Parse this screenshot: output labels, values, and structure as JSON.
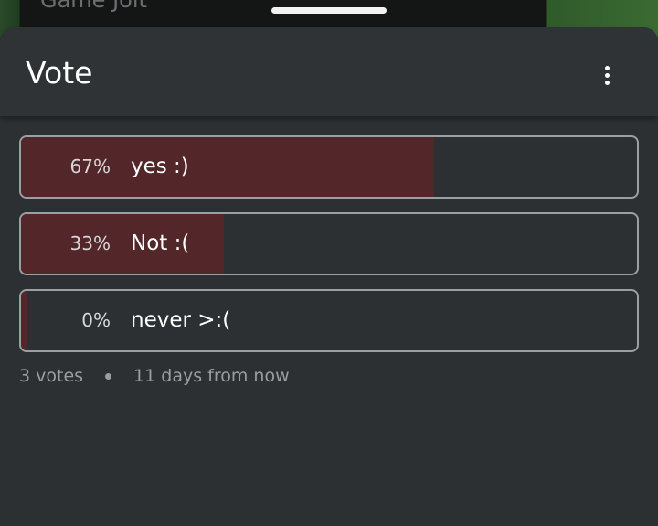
{
  "background": {
    "app_title": "Game Jolt"
  },
  "sheet": {
    "title": "Vote"
  },
  "poll": {
    "options": [
      {
        "percent_label": "67%",
        "label": "yes :)",
        "percent": 67
      },
      {
        "percent_label": "33%",
        "label": "Not :(",
        "percent": 33
      },
      {
        "percent_label": "0%",
        "label": "never >:(",
        "percent": 0
      }
    ],
    "votes_label": "3 votes",
    "time_label": "11 days from now"
  },
  "colors": {
    "fill": "#532629",
    "border": "#9b9fa2",
    "sheet_bg": "#2c3032"
  },
  "icons": {
    "menu": "more-vertical-icon"
  }
}
